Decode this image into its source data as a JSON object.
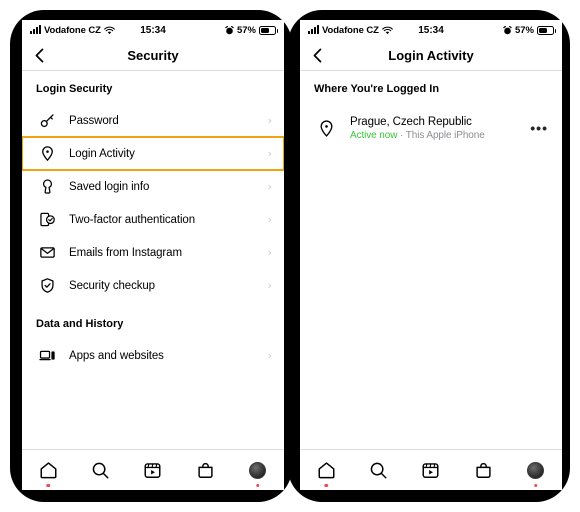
{
  "colors": {
    "highlight_border": "#eea412",
    "active_green": "#3ac63a",
    "badge_red": "#ed4956",
    "chevron_gray": "#c7c7cc",
    "separator": "#dbdbdb",
    "secondary_text": "#8e8e93"
  },
  "status_bar": {
    "carrier": "Vodafone CZ",
    "time": "15:34",
    "battery_percent": "57%",
    "signal_icon": "signal-bars-icon",
    "wifi_icon": "wifi-icon",
    "alarm_icon": "alarm-clock-icon",
    "battery_icon": "battery-icon"
  },
  "left_phone": {
    "nav": {
      "back_icon": "chevron-left-icon",
      "title": "Security"
    },
    "sections": [
      {
        "header": "Login Security",
        "items": [
          {
            "label": "Password",
            "icon": "key-icon",
            "highlighted": false,
            "chevron": "›"
          },
          {
            "label": "Login Activity",
            "icon": "location-pin-icon",
            "highlighted": true,
            "chevron": "›"
          },
          {
            "label": "Saved login info",
            "icon": "keyhole-icon",
            "highlighted": false,
            "chevron": "›"
          },
          {
            "label": "Two-factor authentication",
            "icon": "shield-check-icon",
            "highlighted": false,
            "chevron": "›"
          },
          {
            "label": "Emails from Instagram",
            "icon": "envelope-icon",
            "highlighted": false,
            "chevron": "›"
          },
          {
            "label": "Security checkup",
            "icon": "shield-tick-icon",
            "highlighted": false,
            "chevron": "›"
          }
        ]
      },
      {
        "header": "Data and History",
        "items": [
          {
            "label": "Apps and websites",
            "icon": "devices-icon",
            "highlighted": false,
            "chevron": "›"
          }
        ]
      }
    ]
  },
  "right_phone": {
    "nav": {
      "back_icon": "chevron-left-icon",
      "title": "Login Activity"
    },
    "section_header": "Where You're Logged In",
    "sessions": [
      {
        "icon": "location-pin-icon",
        "place": "Prague, Czech Republic",
        "status": "Active now",
        "separator": " · ",
        "device": "This Apple iPhone",
        "more_icon": "more-options-icon"
      }
    ]
  },
  "tabbar": {
    "items": [
      {
        "name": "home",
        "icon": "home-icon",
        "badge": true
      },
      {
        "name": "search",
        "icon": "search-icon",
        "badge": false
      },
      {
        "name": "reels",
        "icon": "reels-icon",
        "badge": false
      },
      {
        "name": "shop",
        "icon": "shop-bag-icon",
        "badge": false
      },
      {
        "name": "profile",
        "icon": "avatar-icon",
        "badge": true
      }
    ]
  }
}
